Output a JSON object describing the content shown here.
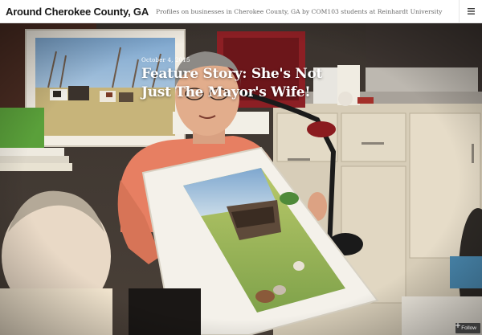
{
  "header": {
    "site_title": "Around Cherokee County, GA",
    "tagline": "Profiles on businesses in Cherokee County, GA by COM103 students at Reinhardt University",
    "menu_icon": "hamburger-menu-icon"
  },
  "post": {
    "date": "October 4, 2015",
    "title": "Feature Story: She's Not Just The Mayor's Wife!"
  },
  "follow": {
    "label": "Follow",
    "icon": "plus-icon"
  },
  "colors": {
    "header_bg": "#ffffff",
    "title_text": "#1a1a1a",
    "overlay_text": "#ffffff"
  }
}
